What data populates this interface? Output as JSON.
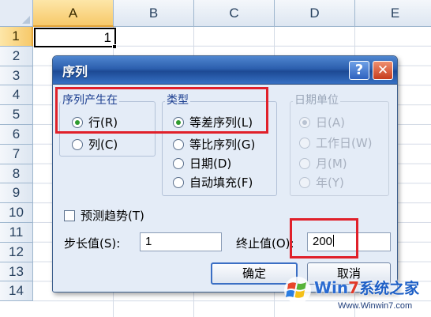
{
  "sheet": {
    "columns": [
      "A",
      "B",
      "C",
      "D",
      "E"
    ],
    "rows": [
      "1",
      "2",
      "3",
      "4",
      "5",
      "6",
      "7",
      "8",
      "9",
      "10",
      "11",
      "12",
      "13",
      "14"
    ],
    "active_cell_value": "1"
  },
  "dialog": {
    "title": "序列",
    "help_glyph": "?",
    "close_glyph": "✕",
    "series_in": {
      "label": "序列产生在",
      "options": [
        {
          "label": "行(R)",
          "checked": true
        },
        {
          "label": "列(C)",
          "checked": false
        }
      ]
    },
    "type": {
      "label": "类型",
      "options": [
        {
          "label": "等差序列(L)",
          "checked": true
        },
        {
          "label": "等比序列(G)",
          "checked": false
        },
        {
          "label": "日期(D)",
          "checked": false
        },
        {
          "label": "自动填充(F)",
          "checked": false
        }
      ]
    },
    "date_unit": {
      "label": "日期单位",
      "options": [
        {
          "label": "日(A)",
          "checked": true
        },
        {
          "label": "工作日(W)",
          "checked": false
        },
        {
          "label": "月(M)",
          "checked": false
        },
        {
          "label": "年(Y)",
          "checked": false
        }
      ]
    },
    "trend": {
      "label": "预测趋势(T)",
      "checked": false
    },
    "step": {
      "label": "步长值(S):",
      "value": "1"
    },
    "stop": {
      "label": "终止值(O):",
      "value": "200"
    },
    "ok_label": "确定",
    "cancel_label": "取消",
    "highlight_color": "#e0202a"
  },
  "watermark": {
    "brand_win": "Win",
    "brand_seven": "7",
    "brand_sys": "系统之家",
    "url": "Www.Winwin7.com"
  }
}
